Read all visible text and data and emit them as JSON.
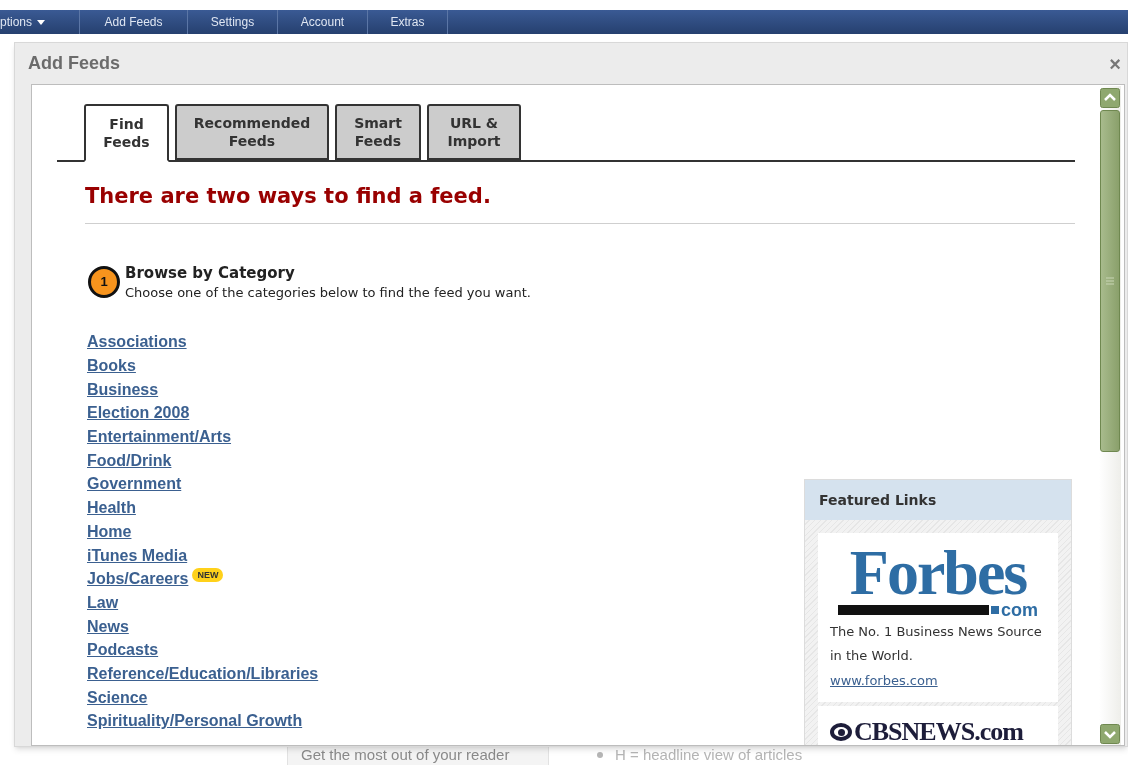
{
  "nav": {
    "items": [
      {
        "label": "ptions",
        "dropdown": true
      },
      {
        "label": "Add Feeds",
        "dropdown": false
      },
      {
        "label": "Settings",
        "dropdown": false
      },
      {
        "label": "Account",
        "dropdown": false
      },
      {
        "label": "Extras",
        "dropdown": false
      }
    ]
  },
  "background": {
    "tip": "Get the most out of your reader",
    "bullet": "H = headline view of articles"
  },
  "dialog": {
    "title": "Add Feeds",
    "close": "×",
    "tabs": [
      {
        "label": "Find Feeds",
        "selected": true
      },
      {
        "label": "Recommended Feeds",
        "selected": false
      },
      {
        "label": "Smart Feeds",
        "selected": false
      },
      {
        "label": "URL & Import",
        "selected": false
      }
    ],
    "heading": "There are two ways to find a feed.",
    "step": {
      "number": "1",
      "title": "Browse by Category",
      "subtitle": "Choose one of the categories below to find the feed you want."
    },
    "categories": [
      {
        "label": "Associations"
      },
      {
        "label": "Books"
      },
      {
        "label": "Business"
      },
      {
        "label": "Election 2008"
      },
      {
        "label": "Entertainment/Arts"
      },
      {
        "label": "Food/Drink"
      },
      {
        "label": "Government"
      },
      {
        "label": "Health"
      },
      {
        "label": "Home"
      },
      {
        "label": "iTunes Media"
      },
      {
        "label": "Jobs/Careers",
        "badge": "NEW"
      },
      {
        "label": "Law"
      },
      {
        "label": "News"
      },
      {
        "label": "Podcasts"
      },
      {
        "label": "Reference/Education/Libraries"
      },
      {
        "label": "Science"
      },
      {
        "label": "Spirituality/Personal Growth"
      }
    ],
    "featured": {
      "title": "Featured Links",
      "items": [
        {
          "kind": "forbes",
          "logo": "Forbes",
          "logo_suffix": "com",
          "description": "The No. 1 Business News Source in the World.",
          "link": "www.forbes.com"
        },
        {
          "kind": "cbs",
          "logo": "CBSNEWS.com"
        }
      ]
    }
  }
}
